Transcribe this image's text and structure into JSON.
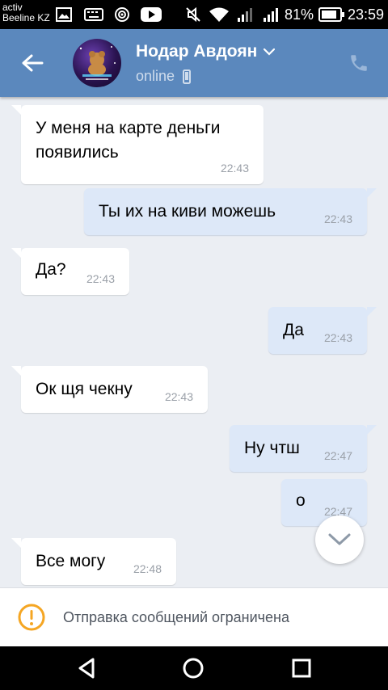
{
  "status_bar": {
    "carrier_line1": "activ",
    "carrier_line2": "Beeline KZ",
    "battery": "81%",
    "time": "23:59"
  },
  "header": {
    "contact_name": "Нодар Авдоян",
    "status": "online",
    "accent": "#5b88bd"
  },
  "messages": [
    {
      "direction": "in",
      "lines": [
        "У меня на карте деньги",
        "появились"
      ],
      "time": "22:43"
    },
    {
      "direction": "out",
      "text": "Ты их на киви можешь",
      "time": "22:43"
    },
    {
      "direction": "in",
      "text": "Да?",
      "time": "22:43"
    },
    {
      "direction": "out",
      "text": "Да",
      "time": "22:43"
    },
    {
      "direction": "in",
      "text": "Ок щя чекну",
      "time": "22:43"
    },
    {
      "direction": "out",
      "text": "Ну чтш",
      "time": "22:47"
    },
    {
      "direction": "out",
      "text": "о",
      "time": "22:47"
    },
    {
      "direction": "in",
      "text": "Все могу",
      "time": "22:48"
    }
  ],
  "restriction": {
    "text": "Отправка сообщений ограничена",
    "icon": "warning-icon",
    "color": "#f5a623"
  },
  "icons": {
    "back": "arrow-left-icon",
    "call": "phone-icon",
    "scroll": "chevron-down-icon",
    "nav_back": "triangle-back-icon",
    "nav_home": "circle-home-icon",
    "nav_recent": "square-recent-icon"
  }
}
